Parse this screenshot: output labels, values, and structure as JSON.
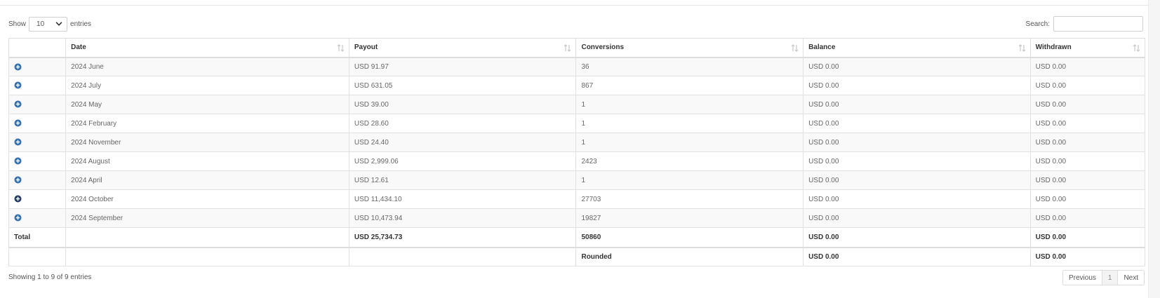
{
  "length": {
    "show_label": "Show",
    "value": "10",
    "entries_label": "entries"
  },
  "search": {
    "label": "Search:",
    "value": ""
  },
  "columns": [
    "",
    "Date",
    "Payout",
    "Conversions",
    "Balance",
    "Withdrawn"
  ],
  "rows": [
    [
      "2024 June",
      "USD 91.97",
      "36",
      "USD 0.00",
      "USD 0.00"
    ],
    [
      "2024 July",
      "USD 631.05",
      "867",
      "USD 0.00",
      "USD 0.00"
    ],
    [
      "2024 May",
      "USD 39.00",
      "1",
      "USD 0.00",
      "USD 0.00"
    ],
    [
      "2024 February",
      "USD 28.60",
      "1",
      "USD 0.00",
      "USD 0.00"
    ],
    [
      "2024 November",
      "USD 24.40",
      "1",
      "USD 0.00",
      "USD 0.00"
    ],
    [
      "2024 August",
      "USD 2,999.06",
      "2423",
      "USD 0.00",
      "USD 0.00"
    ],
    [
      "2024 April",
      "USD 12.61",
      "1",
      "USD 0.00",
      "USD 0.00"
    ],
    [
      "2024 October",
      "USD 11,434.10",
      "27703",
      "USD 0.00",
      "USD 0.00"
    ],
    [
      "2024 September",
      "USD 10,473.94",
      "19827",
      "USD 0.00",
      "USD 0.00"
    ]
  ],
  "footer": {
    "total": [
      "Total",
      "",
      "USD 25,734.73",
      "50860",
      "USD 0.00",
      "USD 0.00"
    ],
    "rounded": [
      "",
      "",
      "",
      "Rounded",
      "USD 0.00",
      "USD 0.00"
    ]
  },
  "info": "Showing 1 to 9 of 9 entries",
  "pagination": {
    "previous": "Previous",
    "current": "1",
    "next": "Next"
  },
  "icons": {
    "row_expand": "plus-circle-icon",
    "sort": "sort-both-icon",
    "select": "chevron-down-icon"
  },
  "colors": {
    "expand_icon": "#2f6eb5",
    "expand_icon_dark": "#1f3b63",
    "stripe": "#f9f9f9",
    "border": "#e1e1e1"
  }
}
